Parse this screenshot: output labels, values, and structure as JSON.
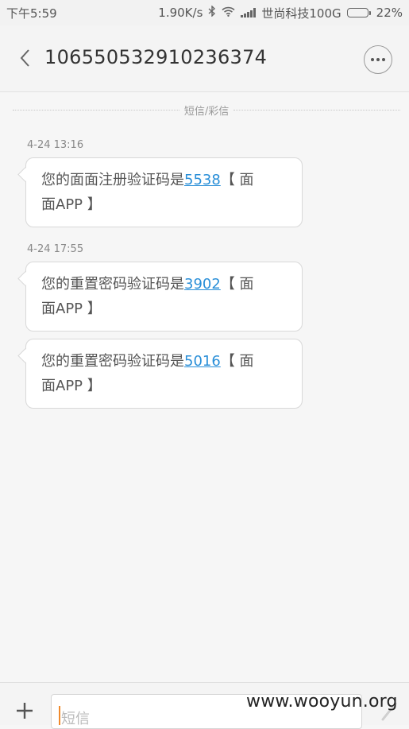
{
  "status_bar": {
    "time": "下午5:59",
    "network_speed": "1.90K/s",
    "bluetooth_icon": "bluetooth-icon",
    "wifi_icon": "wifi-icon",
    "signal_icon": "signal-icon",
    "carrier": "世尚科技100G",
    "battery_percent": "22%",
    "battery_level": 0.22
  },
  "header": {
    "back_icon": "chevron-left-icon",
    "title": "106550532910236374",
    "more_icon": "more-horizontal-icon"
  },
  "conversation": {
    "channel_label": "短信/彩信",
    "groups": [
      {
        "timestamp": "4-24 13:16",
        "messages": [
          {
            "prefix": "您的面面注册验证码是",
            "code": "5538",
            "suffix_line1": "【 面",
            "line2": "面APP 】"
          }
        ]
      },
      {
        "timestamp": "4-24 17:55",
        "messages": [
          {
            "prefix": "您的重置密码验证码是",
            "code": "3902",
            "suffix_line1": "【 面",
            "line2": "面APP 】"
          },
          {
            "prefix": "您的重置密码验证码是",
            "code": "5016",
            "suffix_line1": "【 面",
            "line2": "面APP 】"
          }
        ]
      }
    ]
  },
  "compose": {
    "add_icon": "plus-icon",
    "placeholder": "短信",
    "send_icon": "send-icon"
  },
  "watermark": "www.wooyun.org"
}
